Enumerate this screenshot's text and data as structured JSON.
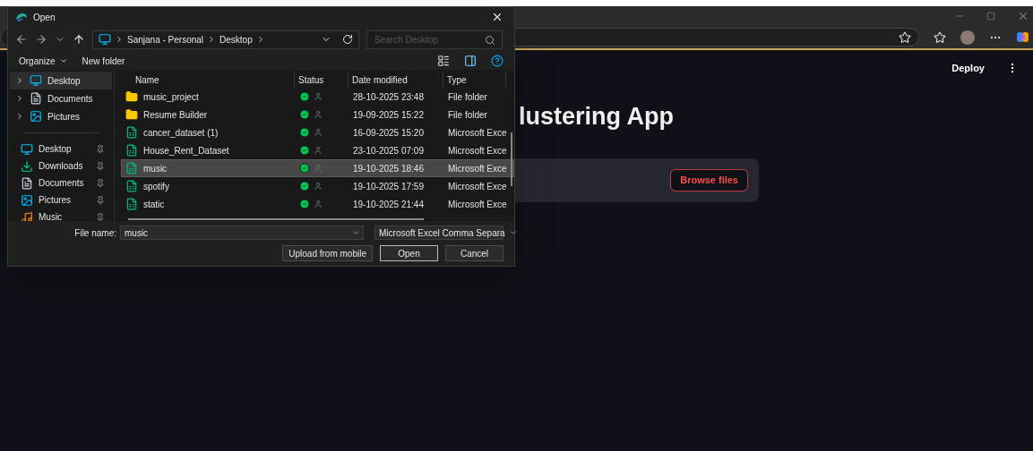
{
  "dialog": {
    "title": "Open",
    "address": [
      "Sanjana - Personal",
      "Desktop"
    ],
    "search": {
      "placeholder": "Search Desktop"
    },
    "toolbar": [
      "Organize",
      "New folder"
    ],
    "tree": [
      {
        "label": "Desktop",
        "kind": "desktop",
        "selected": true
      },
      {
        "label": "Documents",
        "kind": "documents",
        "selected": false
      },
      {
        "label": "Pictures",
        "kind": "pictures",
        "selected": false
      }
    ],
    "quick_access": [
      {
        "label": "Desktop",
        "kind": "desktop",
        "selected": false
      },
      {
        "label": "Downloads",
        "kind": "downloads",
        "selected": false
      },
      {
        "label": "Documents",
        "kind": "documents",
        "selected": false
      },
      {
        "label": "Pictures",
        "kind": "pictures",
        "selected": false
      },
      {
        "label": "Music",
        "kind": "music",
        "selected": false
      }
    ],
    "columns": [
      "Name",
      "Status",
      "Date modified",
      "Type"
    ],
    "files": [
      {
        "name": "music_project",
        "kind": "folder",
        "date": "28-10-2025 23:48",
        "type": "File folder",
        "selected": false
      },
      {
        "name": "Resume Builder",
        "kind": "folder",
        "date": "19-09-2025 15:22",
        "type": "File folder",
        "selected": false
      },
      {
        "name": "cancer_dataset (1)",
        "kind": "spreadsheet",
        "date": "16-09-2025 15:20",
        "type": "Microsoft Exce",
        "selected": false
      },
      {
        "name": "House_Rent_Dataset",
        "kind": "spreadsheet",
        "date": "23-10-2025 07:09",
        "type": "Microsoft Exce",
        "selected": false
      },
      {
        "name": "music",
        "kind": "spreadsheet",
        "date": "19-10-2025 18:46",
        "type": "Microsoft Exce",
        "selected": true
      },
      {
        "name": "spotify",
        "kind": "spreadsheet",
        "date": "19-10-2025 17:59",
        "type": "Microsoft Exce",
        "selected": false
      },
      {
        "name": "static",
        "kind": "spreadsheet",
        "date": "19-10-2025 21:44",
        "type": "Microsoft Exce",
        "selected": false
      }
    ],
    "file_name": {
      "label": "File name:",
      "value": "music"
    },
    "file_type": "Microsoft Excel Comma Separa",
    "buttons": [
      "Upload from mobile",
      "Open",
      "Cancel"
    ]
  },
  "app": {
    "deploy": "Deploy",
    "title": "lustering App",
    "upload_button": "Browse files"
  }
}
